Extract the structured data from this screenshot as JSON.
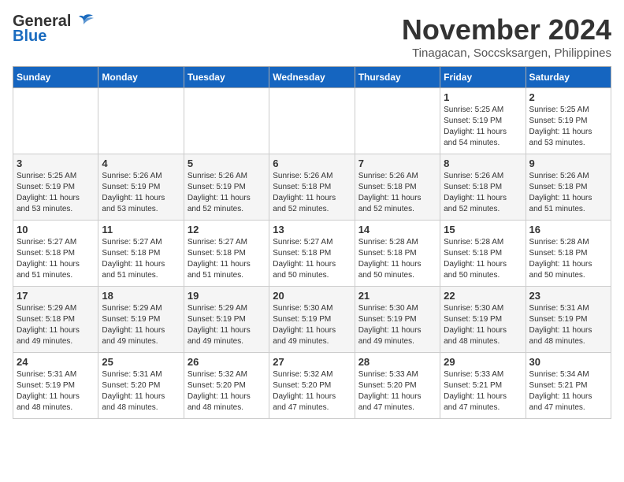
{
  "header": {
    "logo_general": "General",
    "logo_blue": "Blue",
    "month": "November 2024",
    "location": "Tinagacan, Soccsksargen, Philippines"
  },
  "days_of_week": [
    "Sunday",
    "Monday",
    "Tuesday",
    "Wednesday",
    "Thursday",
    "Friday",
    "Saturday"
  ],
  "weeks": [
    [
      {
        "day": "",
        "info": ""
      },
      {
        "day": "",
        "info": ""
      },
      {
        "day": "",
        "info": ""
      },
      {
        "day": "",
        "info": ""
      },
      {
        "day": "",
        "info": ""
      },
      {
        "day": "1",
        "info": "Sunrise: 5:25 AM\nSunset: 5:19 PM\nDaylight: 11 hours\nand 54 minutes."
      },
      {
        "day": "2",
        "info": "Sunrise: 5:25 AM\nSunset: 5:19 PM\nDaylight: 11 hours\nand 53 minutes."
      }
    ],
    [
      {
        "day": "3",
        "info": "Sunrise: 5:25 AM\nSunset: 5:19 PM\nDaylight: 11 hours\nand 53 minutes."
      },
      {
        "day": "4",
        "info": "Sunrise: 5:26 AM\nSunset: 5:19 PM\nDaylight: 11 hours\nand 53 minutes."
      },
      {
        "day": "5",
        "info": "Sunrise: 5:26 AM\nSunset: 5:19 PM\nDaylight: 11 hours\nand 52 minutes."
      },
      {
        "day": "6",
        "info": "Sunrise: 5:26 AM\nSunset: 5:18 PM\nDaylight: 11 hours\nand 52 minutes."
      },
      {
        "day": "7",
        "info": "Sunrise: 5:26 AM\nSunset: 5:18 PM\nDaylight: 11 hours\nand 52 minutes."
      },
      {
        "day": "8",
        "info": "Sunrise: 5:26 AM\nSunset: 5:18 PM\nDaylight: 11 hours\nand 52 minutes."
      },
      {
        "day": "9",
        "info": "Sunrise: 5:26 AM\nSunset: 5:18 PM\nDaylight: 11 hours\nand 51 minutes."
      }
    ],
    [
      {
        "day": "10",
        "info": "Sunrise: 5:27 AM\nSunset: 5:18 PM\nDaylight: 11 hours\nand 51 minutes."
      },
      {
        "day": "11",
        "info": "Sunrise: 5:27 AM\nSunset: 5:18 PM\nDaylight: 11 hours\nand 51 minutes."
      },
      {
        "day": "12",
        "info": "Sunrise: 5:27 AM\nSunset: 5:18 PM\nDaylight: 11 hours\nand 51 minutes."
      },
      {
        "day": "13",
        "info": "Sunrise: 5:27 AM\nSunset: 5:18 PM\nDaylight: 11 hours\nand 50 minutes."
      },
      {
        "day": "14",
        "info": "Sunrise: 5:28 AM\nSunset: 5:18 PM\nDaylight: 11 hours\nand 50 minutes."
      },
      {
        "day": "15",
        "info": "Sunrise: 5:28 AM\nSunset: 5:18 PM\nDaylight: 11 hours\nand 50 minutes."
      },
      {
        "day": "16",
        "info": "Sunrise: 5:28 AM\nSunset: 5:18 PM\nDaylight: 11 hours\nand 50 minutes."
      }
    ],
    [
      {
        "day": "17",
        "info": "Sunrise: 5:29 AM\nSunset: 5:18 PM\nDaylight: 11 hours\nand 49 minutes."
      },
      {
        "day": "18",
        "info": "Sunrise: 5:29 AM\nSunset: 5:19 PM\nDaylight: 11 hours\nand 49 minutes."
      },
      {
        "day": "19",
        "info": "Sunrise: 5:29 AM\nSunset: 5:19 PM\nDaylight: 11 hours\nand 49 minutes."
      },
      {
        "day": "20",
        "info": "Sunrise: 5:30 AM\nSunset: 5:19 PM\nDaylight: 11 hours\nand 49 minutes."
      },
      {
        "day": "21",
        "info": "Sunrise: 5:30 AM\nSunset: 5:19 PM\nDaylight: 11 hours\nand 49 minutes."
      },
      {
        "day": "22",
        "info": "Sunrise: 5:30 AM\nSunset: 5:19 PM\nDaylight: 11 hours\nand 48 minutes."
      },
      {
        "day": "23",
        "info": "Sunrise: 5:31 AM\nSunset: 5:19 PM\nDaylight: 11 hours\nand 48 minutes."
      }
    ],
    [
      {
        "day": "24",
        "info": "Sunrise: 5:31 AM\nSunset: 5:19 PM\nDaylight: 11 hours\nand 48 minutes."
      },
      {
        "day": "25",
        "info": "Sunrise: 5:31 AM\nSunset: 5:20 PM\nDaylight: 11 hours\nand 48 minutes."
      },
      {
        "day": "26",
        "info": "Sunrise: 5:32 AM\nSunset: 5:20 PM\nDaylight: 11 hours\nand 48 minutes."
      },
      {
        "day": "27",
        "info": "Sunrise: 5:32 AM\nSunset: 5:20 PM\nDaylight: 11 hours\nand 47 minutes."
      },
      {
        "day": "28",
        "info": "Sunrise: 5:33 AM\nSunset: 5:20 PM\nDaylight: 11 hours\nand 47 minutes."
      },
      {
        "day": "29",
        "info": "Sunrise: 5:33 AM\nSunset: 5:21 PM\nDaylight: 11 hours\nand 47 minutes."
      },
      {
        "day": "30",
        "info": "Sunrise: 5:34 AM\nSunset: 5:21 PM\nDaylight: 11 hours\nand 47 minutes."
      }
    ]
  ]
}
